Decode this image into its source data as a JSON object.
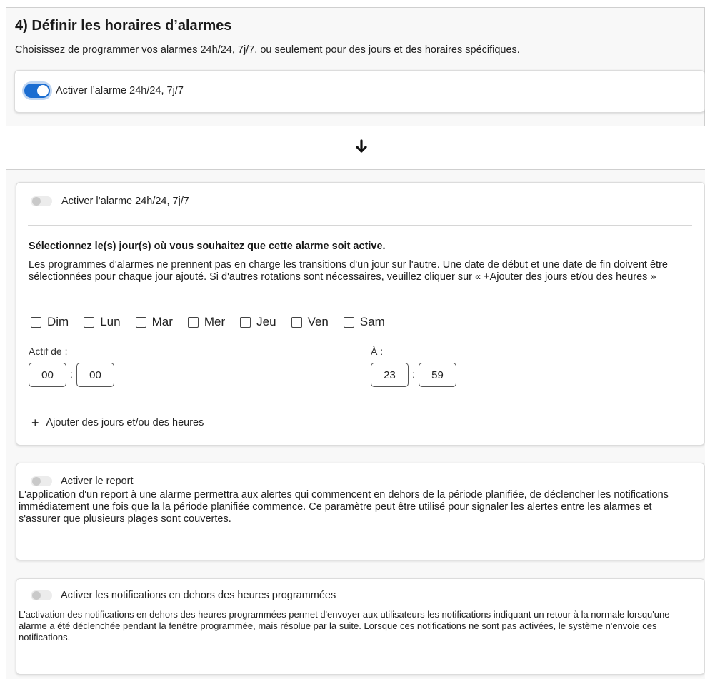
{
  "top_panel": {
    "title": "4) Définir les horaires d’alarmes",
    "subtitle": "Choisissez de programmer vos alarmes 24h/24, 7j/7, ou seulement pour des jours et des horaires spécifiques.",
    "toggle_label": "Activer l’alarme 24h/24, 7j/7",
    "toggle_state": "on"
  },
  "arrow_icon": "arrow-down",
  "schedule_card": {
    "toggle_label": "Activer l’alarme 24h/24, 7j/7",
    "toggle_state": "off",
    "section_title": "Sélectionnez le(s) jour(s) où vous souhaitez que cette alarme soit active.",
    "description": "Les programmes d'alarmes ne prennent pas en charge les transitions d'un jour sur l'autre. Une date de début et une date de fin doivent être sélectionnées pour chaque jour ajouté. Si d'autres rotations sont nécessaires, veuillez cliquer sur « +Ajouter des jours et/ou des heures »",
    "days": [
      {
        "label": "Dim",
        "checked": false
      },
      {
        "label": "Lun",
        "checked": false
      },
      {
        "label": "Mar",
        "checked": false
      },
      {
        "label": "Mer",
        "checked": false
      },
      {
        "label": "Jeu",
        "checked": false
      },
      {
        "label": "Ven",
        "checked": false
      },
      {
        "label": "Sam",
        "checked": false
      }
    ],
    "from_label": "Actif de :",
    "from_hour": "00",
    "from_minute": "00",
    "to_label": "À :",
    "to_hour": "23",
    "to_minute": "59",
    "separator": ":",
    "add_link_label": "Ajouter des jours et/ou des heures",
    "add_link_icon": "plus"
  },
  "report_card": {
    "toggle_label": "Activer le report",
    "toggle_state": "off",
    "description": "L'application d'un report à une alarme permettra aux alertes qui commencent en dehors de la période planifiée, de déclencher les notifications immédiatement une fois que la la période planifiée commence. Ce paramètre peut être utilisé pour signaler les alertes entre les alarmes et s'assurer que plusieurs plages sont couvertes."
  },
  "notifications_card": {
    "toggle_label": "Activer les notifications en dehors des heures programmées",
    "toggle_state": "off",
    "description": "L'activation des notifications en dehors des heures programmées permet d'envoyer aux utilisateurs les notifications indiquant un retour à la normale lorsqu'une alarme a été déclenchée pendant la fenêtre programmée, mais résolue par la suite. Lorsque ces notifications ne sont pas activées, le système n'envoie ces notifications."
  },
  "colors": {
    "accent": "#1b6dd1",
    "panel_bg": "#f8f8f8",
    "card_bg": "#ffffff"
  }
}
